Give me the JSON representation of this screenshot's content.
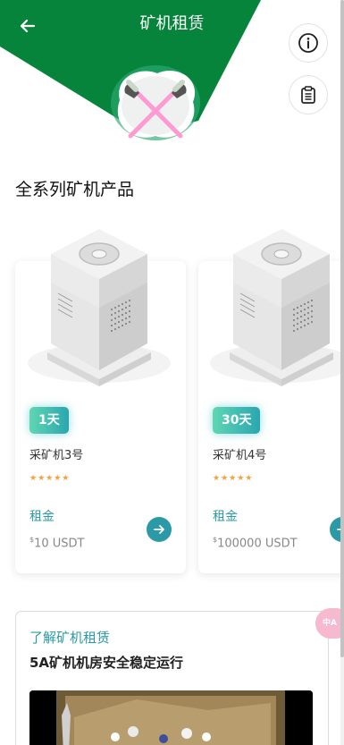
{
  "header": {
    "title": "矿机租赁",
    "back_icon": "arrow-left-icon",
    "info_icon": "info-circle-icon",
    "records_icon": "clipboard-icon"
  },
  "colors": {
    "header_green": "#07843b",
    "accent_teal": "#2b9aa6",
    "star_orange": "#f5a13a",
    "badge_gradient_start": "#5fd7b3",
    "badge_gradient_end": "#2aa6b0"
  },
  "section_title": "全系列矿机产品",
  "products": [
    {
      "duration": "1天",
      "name": "采矿机3号",
      "rating": 5,
      "stars": "★★★★★",
      "rent_label": "租金",
      "currency_symbol": "$",
      "price": "10 USDT"
    },
    {
      "duration": "30天",
      "name": "采矿机4号",
      "rating": 5,
      "stars": "★★★★★",
      "rent_label": "租金",
      "currency_symbol": "$",
      "price": "100000 USDT"
    }
  ],
  "about": {
    "kicker": "了解矿机租赁",
    "heading": "5A矿机机房安全稳定运行"
  },
  "translate_fab": {
    "text": "中A"
  }
}
